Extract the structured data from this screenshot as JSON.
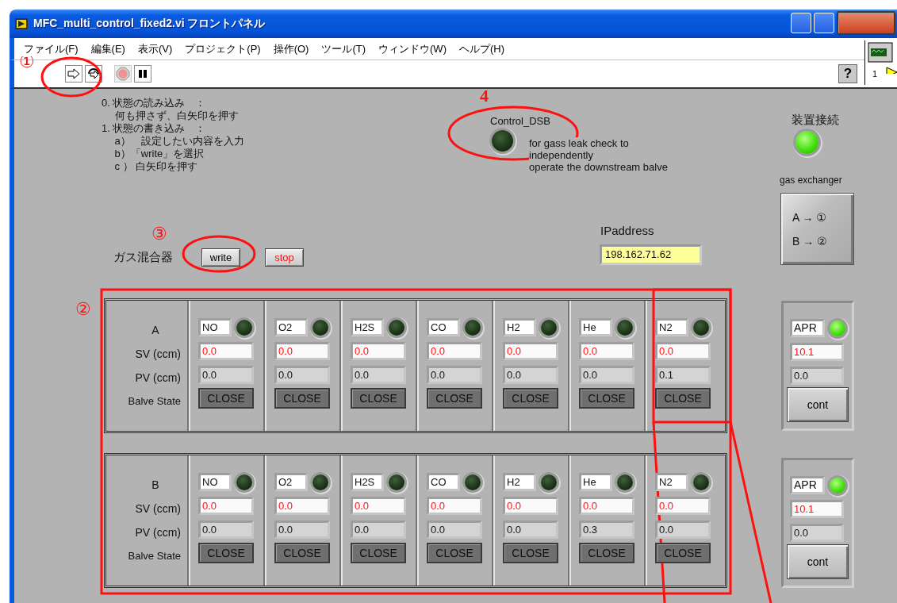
{
  "window": {
    "title": "MFC_multi_control_fixed2.vi フロントパネル"
  },
  "menu": [
    "ファイル(F)",
    "編集(E)",
    "表示(V)",
    "プロジェクト(P)",
    "操作(O)",
    "ツール(T)",
    "ウィンドウ(W)",
    "ヘルプ(H)"
  ],
  "toolbar": {
    "help": "?",
    "vi_icon_number": "1"
  },
  "panel": {
    "instructions": [
      "0. 状態の読み込み　：",
      "　 何も押さず、白矢印を押す",
      "1. 状態の書き込み　：",
      "　 a）　設定したい内容を入力",
      "　  b）「write」を選択",
      "　 c ）  白矢印を押す"
    ],
    "control_dsb": {
      "label": "Control_DSB",
      "on": false,
      "note": [
        "for gass leak check to",
        "independently",
        "operate the downstream balve"
      ]
    },
    "device_connection": {
      "label": "装置接続",
      "on": true
    },
    "gas_exchanger": {
      "label": "gas exchanger",
      "lines": [
        "A → ①",
        "B → ②"
      ]
    },
    "ip_address": {
      "label": "IPaddress",
      "value": "198.162.71.62"
    },
    "mixer": {
      "label": "ガス混合器",
      "buttons": [
        {
          "label": "write",
          "kind": "normal"
        },
        {
          "label": "stop",
          "kind": "alert"
        }
      ]
    },
    "clusters": [
      {
        "name": "A",
        "row_labels": [
          "SV (ccm)",
          "PV (ccm)",
          "Balve State"
        ],
        "channels": [
          {
            "gas": "NO",
            "on": false,
            "sv": "0.0",
            "pv": "0.0",
            "state": "CLOSE"
          },
          {
            "gas": "O2",
            "on": false,
            "sv": "0.0",
            "pv": "0.0",
            "state": "CLOSE"
          },
          {
            "gas": "H2S",
            "on": false,
            "sv": "0.0",
            "pv": "0.0",
            "state": "CLOSE"
          },
          {
            "gas": "CO",
            "on": false,
            "sv": "0.0",
            "pv": "0.0",
            "state": "CLOSE"
          },
          {
            "gas": "H2",
            "on": false,
            "sv": "0.0",
            "pv": "0.0",
            "state": "CLOSE"
          },
          {
            "gas": "He",
            "on": false,
            "sv": "0.0",
            "pv": "0.0",
            "state": "CLOSE"
          },
          {
            "gas": "N2",
            "on": false,
            "sv": "0.0",
            "pv": "0.1",
            "state": "CLOSE"
          }
        ]
      },
      {
        "name": "B",
        "row_labels": [
          "SV (ccm)",
          "PV (ccm)",
          "Balve State"
        ],
        "channels": [
          {
            "gas": "NO",
            "on": false,
            "sv": "0.0",
            "pv": "0.0",
            "state": "CLOSE"
          },
          {
            "gas": "O2",
            "on": false,
            "sv": "0.0",
            "pv": "0.0",
            "state": "CLOSE"
          },
          {
            "gas": "H2S",
            "on": false,
            "sv": "0.0",
            "pv": "0.0",
            "state": "CLOSE"
          },
          {
            "gas": "CO",
            "on": false,
            "sv": "0.0",
            "pv": "0.0",
            "state": "CLOSE"
          },
          {
            "gas": "H2",
            "on": false,
            "sv": "0.0",
            "pv": "0.0",
            "state": "CLOSE"
          },
          {
            "gas": "He",
            "on": false,
            "sv": "0.0",
            "pv": "0.3",
            "state": "CLOSE"
          },
          {
            "gas": "N2",
            "on": false,
            "sv": "0.0",
            "pv": "0.0",
            "state": "CLOSE"
          }
        ]
      }
    ],
    "apr": [
      {
        "name": "APR",
        "on": true,
        "sv": "10.1",
        "pv": "0.0",
        "button": "cont"
      },
      {
        "name": "APR",
        "on": true,
        "sv": "10.1",
        "pv": "0.0",
        "button": "cont"
      }
    ]
  },
  "annotations": [
    {
      "label": "①"
    },
    {
      "label": "②"
    },
    {
      "label": "③"
    },
    {
      "label": "4"
    }
  ]
}
